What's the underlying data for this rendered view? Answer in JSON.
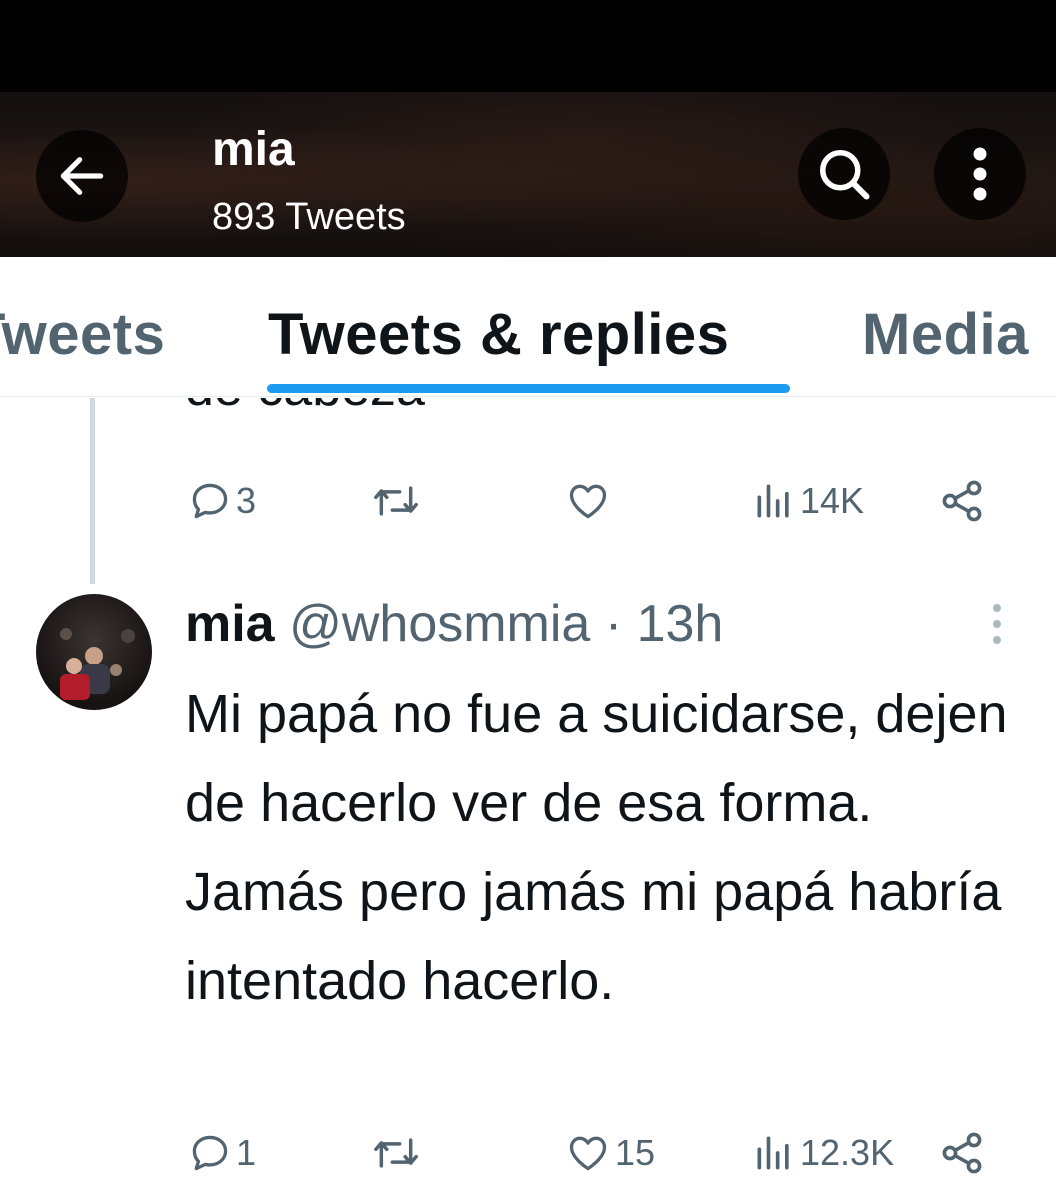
{
  "header": {
    "name": "mia",
    "tweet_count": "893 Tweets"
  },
  "tabs": [
    {
      "label": "Tweets"
    },
    {
      "label": "Tweets & replies"
    },
    {
      "label": "Media"
    }
  ],
  "accent_color": "#1d9bf0",
  "previous_tweet": {
    "text_fragment": "de cabeza",
    "replies": "3",
    "retweets": "",
    "likes": "",
    "views": "14K"
  },
  "tweet": {
    "name": "mia",
    "handle": "@whosmmia",
    "separator": "·",
    "time": "13h",
    "text": "Mi papá no fue a suicidarse, dejen de hacerlo ver de esa forma. Jamás pero jamás mi papá habría intentado hacerlo.",
    "replies": "1",
    "retweets": "",
    "likes": "15",
    "views": "12.3K"
  },
  "icons": [
    "back-arrow-icon",
    "search-icon",
    "more-vertical-icon",
    "reply-icon",
    "retweet-icon",
    "like-icon",
    "views-icon",
    "share-icon"
  ]
}
